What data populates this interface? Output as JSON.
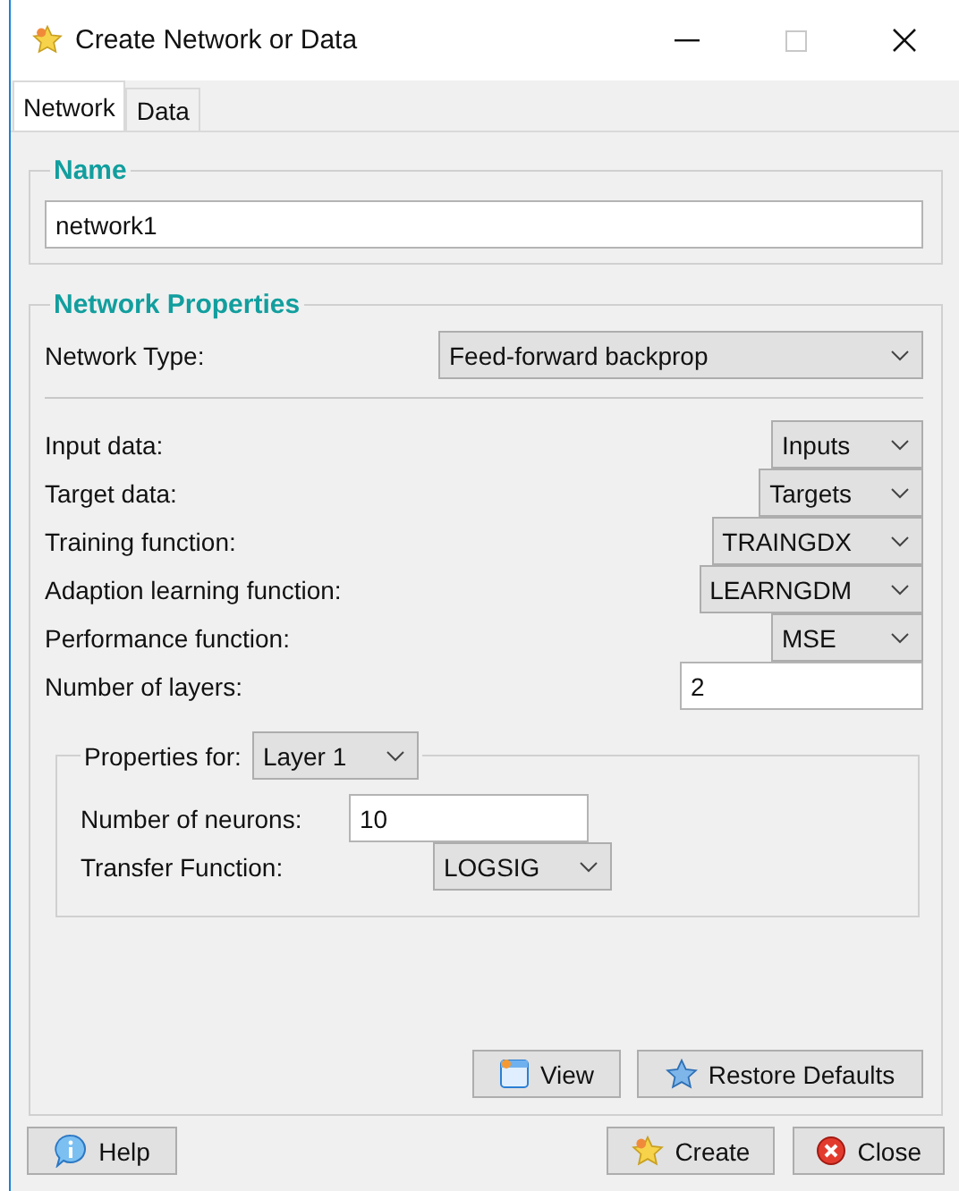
{
  "window": {
    "title": "Create Network or Data"
  },
  "tabs": [
    {
      "label": "Network",
      "selected": true
    },
    {
      "label": "Data",
      "selected": false
    }
  ],
  "name_section": {
    "legend": "Name",
    "value": "network1"
  },
  "network_properties": {
    "legend": "Network Properties",
    "network_type": {
      "label": "Network Type:",
      "value": "Feed-forward backprop"
    },
    "fields": [
      {
        "kind": "select",
        "label": "Input data:",
        "value": "Inputs"
      },
      {
        "kind": "select",
        "label": "Target data:",
        "value": "Targets"
      },
      {
        "kind": "select",
        "label": "Training function:",
        "value": "TRAINGDX"
      },
      {
        "kind": "select",
        "label": "Adaption learning function:",
        "value": "LEARNGDM"
      },
      {
        "kind": "select",
        "label": "Performance function:",
        "value": "MSE"
      },
      {
        "kind": "input",
        "label": "Number of layers:",
        "value": "2"
      }
    ],
    "layer_properties": {
      "label": "Properties for:",
      "layer": "Layer 1",
      "fields": [
        {
          "kind": "input",
          "label": "Number of neurons:",
          "value": "10"
        },
        {
          "kind": "select",
          "label": "Transfer Function:",
          "value": "LOGSIG"
        }
      ]
    },
    "buttons": [
      {
        "label": "View"
      },
      {
        "label": "Restore Defaults"
      }
    ]
  },
  "footer": {
    "left_buttons": [
      {
        "label": "Help"
      }
    ],
    "right_buttons": [
      {
        "label": "Create"
      },
      {
        "label": "Close"
      }
    ]
  }
}
